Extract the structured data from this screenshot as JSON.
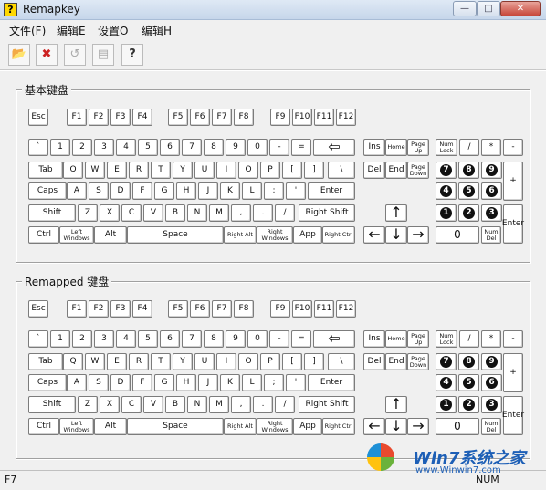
{
  "window": {
    "title": "Remapkey",
    "app_icon": "?",
    "min": "—",
    "max": "□",
    "close": "✕"
  },
  "menu": [
    "文件(F)",
    "编辑E",
    "设置O",
    "编辑H"
  ],
  "toolbar": [
    {
      "name": "open-icon",
      "glyph": "📂",
      "enabled": true
    },
    {
      "name": "delete-icon",
      "glyph": "✖",
      "enabled": true
    },
    {
      "name": "reset-icon",
      "glyph": "↺",
      "enabled": false
    },
    {
      "name": "document-icon",
      "glyph": "▤",
      "enabled": false
    },
    {
      "name": "help-icon",
      "glyph": "?",
      "enabled": true
    }
  ],
  "groups": [
    {
      "label": "基本键盘"
    },
    {
      "label": "Remapped 键盘"
    }
  ],
  "keys": {
    "fn": [
      "Esc",
      "F1",
      "F2",
      "F3",
      "F4",
      "F5",
      "F6",
      "F7",
      "F8",
      "F9",
      "F10",
      "F11",
      "F12"
    ],
    "num_row": [
      "`",
      "1",
      "2",
      "3",
      "4",
      "5",
      "6",
      "7",
      "8",
      "9",
      "0",
      "-",
      "=",
      "⇦"
    ],
    "tab_row": [
      "Tab",
      "Q",
      "W",
      "E",
      "R",
      "T",
      "Y",
      "U",
      "I",
      "O",
      "P",
      "[",
      "]",
      "\\"
    ],
    "caps_row": [
      "Caps",
      "A",
      "S",
      "D",
      "F",
      "G",
      "H",
      "J",
      "K",
      "L",
      ";",
      "'",
      "Enter"
    ],
    "shift_row": [
      "Shift",
      "Z",
      "X",
      "C",
      "V",
      "B",
      "N",
      "M",
      ",",
      ".",
      "/",
      "Right Shift"
    ],
    "ctrl_row": [
      "Ctrl",
      "Left Windows",
      "Alt",
      "Space",
      "Right Alt",
      "Right Windows",
      "App",
      "Right Ctrl"
    ],
    "nav_top": [
      "Ins",
      "Home",
      "Page Up"
    ],
    "nav_bottom": [
      "Del",
      "End",
      "Page Down"
    ],
    "arrows": [
      "↑",
      "←",
      "↓",
      "→"
    ],
    "numpad_ops": [
      "Num Lock",
      "/",
      "*",
      "-"
    ],
    "numpad_digits": [
      "7",
      "8",
      "9",
      "4",
      "5",
      "6",
      "1",
      "2",
      "3"
    ],
    "numpad_zero": "0",
    "numpad_del": "Num Del",
    "numpad_plus": "+",
    "numpad_enter": "Enter"
  },
  "status": {
    "left": "F7",
    "right": "NUM"
  },
  "watermark": {
    "text": "Win7系统之家",
    "url": "www.Winwin7.com"
  }
}
